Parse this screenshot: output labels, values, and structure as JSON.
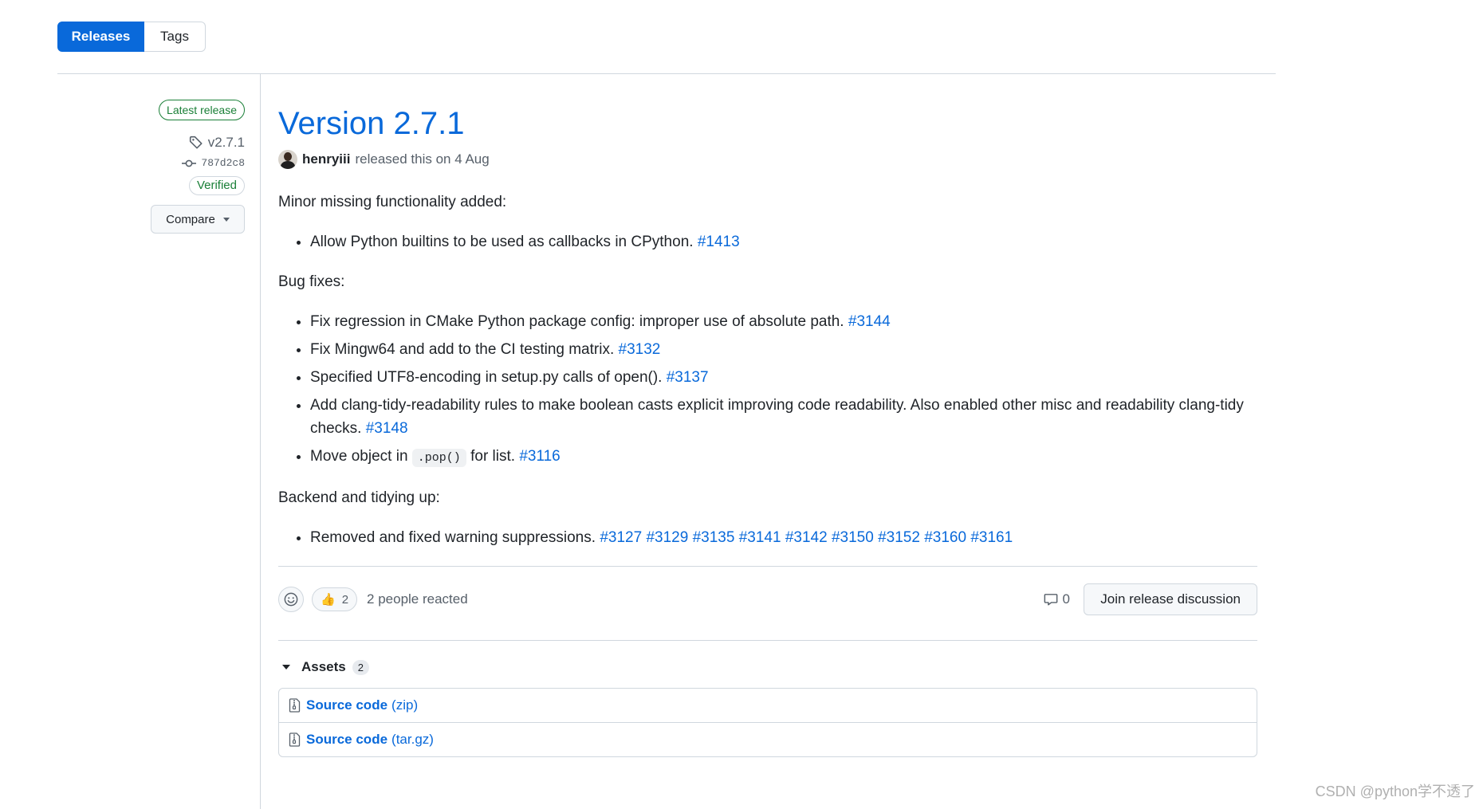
{
  "tabs": {
    "releases": "Releases",
    "tags": "Tags"
  },
  "sidebar": {
    "latest_badge": "Latest release",
    "tag": "v2.7.1",
    "commit": "787d2c8",
    "verified": "Verified",
    "compare": "Compare"
  },
  "release": {
    "title": "Version 2.7.1",
    "author": "henryiii",
    "released_text": "released this on 4 Aug",
    "sections": {
      "minor": {
        "heading": "Minor missing functionality added:",
        "items": [
          {
            "text": "Allow Python builtins to be used as callbacks in CPython.",
            "ref": "#1413"
          }
        ]
      },
      "bugfixes": {
        "heading": "Bug fixes:",
        "items": [
          {
            "text": "Fix regression in CMake Python package config: improper use of absolute path.",
            "ref": "#3144"
          },
          {
            "text": "Fix Mingw64 and add to the CI testing matrix.",
            "ref": "#3132"
          },
          {
            "text": "Specified UTF8-encoding in setup.py calls of open().",
            "ref": "#3137"
          },
          {
            "text": "Add clang-tidy-readability rules to make boolean casts explicit improving code readability. Also enabled other misc and readability clang-tidy checks.",
            "ref": "#3148"
          },
          {
            "text_before": "Move object in",
            "code": ".pop()",
            "text_after": "for list.",
            "ref": "#3116"
          }
        ]
      },
      "backend": {
        "heading": "Backend and tidying up:",
        "items": [
          {
            "text": "Removed and fixed warning suppressions.",
            "refs": [
              "#3127",
              "#3129",
              "#3135",
              "#3141",
              "#3142",
              "#3150",
              "#3152",
              "#3160",
              "#3161"
            ]
          }
        ]
      }
    }
  },
  "reactions": {
    "thumbs_count": "2",
    "people_reacted": "2 people reacted",
    "comments_count": "0",
    "join_discussion": "Join release discussion"
  },
  "assets": {
    "label": "Assets",
    "count": "2",
    "items": [
      {
        "name": "Source code",
        "ext": "(zip)"
      },
      {
        "name": "Source code",
        "ext": "(tar.gz)"
      }
    ]
  },
  "watermark": "CSDN @python学不透了",
  "colors": {
    "accent": "#0969da",
    "success": "#1a7f37",
    "border": "#d0d7de",
    "muted": "#57606a"
  }
}
